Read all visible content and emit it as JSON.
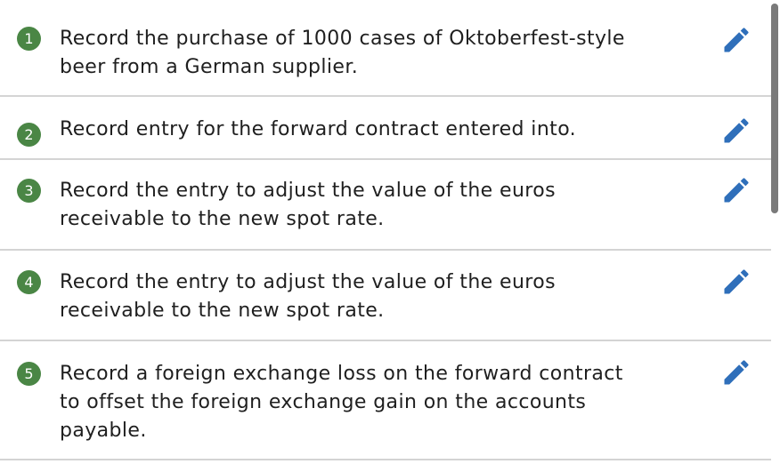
{
  "steps": [
    {
      "number": "1",
      "text": "Record the purchase of 1000 cases of Oktoberfest-style\nbeer from a German supplier.",
      "icon": "pencil-icon"
    },
    {
      "number": "2",
      "text": "Record entry for the forward contract entered into.",
      "icon": "pencil-icon"
    },
    {
      "number": "3",
      "text": "Record the entry to adjust the value of the euros\nreceivable to the new spot rate.",
      "icon": "pencil-icon"
    },
    {
      "number": "4",
      "text": "Record the entry to adjust the value of the euros\nreceivable to the new spot rate.",
      "icon": "pencil-icon"
    },
    {
      "number": "5",
      "text": "Record a foreign exchange loss on the forward contract\nto offset the foreign exchange gain on the accounts\npayable.",
      "icon": "pencil-icon"
    }
  ],
  "colors": {
    "badge": "#4a8645",
    "icon": "#2f6fba",
    "divider": "#d4d4d4",
    "scrollbar": "#7a7a7a"
  }
}
